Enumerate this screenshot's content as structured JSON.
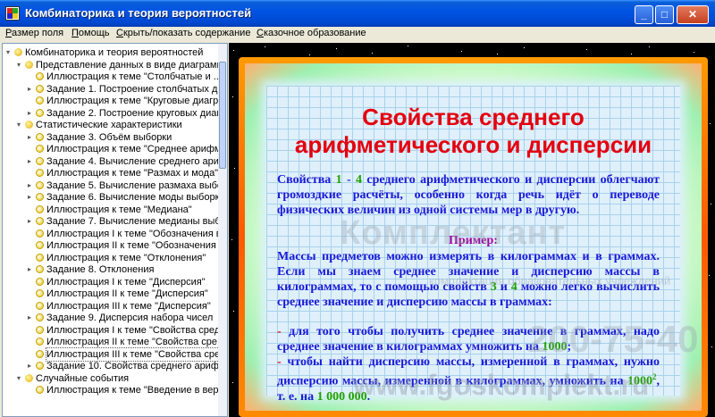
{
  "window": {
    "title": "Комбинаторика и теория вероятностей"
  },
  "menu": {
    "items": [
      {
        "pre": "",
        "u": "Р",
        "post": "азмер поля"
      },
      {
        "pre": "",
        "u": "П",
        "post": "омощь"
      },
      {
        "pre": "",
        "u": "С",
        "post": "крыть/показать содержание"
      },
      {
        "pre": "",
        "u": "С",
        "post": "казочное образование"
      }
    ]
  },
  "tree": [
    {
      "label": "Комбинаторика и теория вероятностей",
      "level": 0,
      "type": "folder",
      "exp": "-"
    },
    {
      "label": "Представление данных в виде диаграмм",
      "level": 1,
      "type": "folder",
      "exp": "-"
    },
    {
      "label": "Иллюстрация к теме \"Столбчатые и ...",
      "level": 2,
      "type": "page",
      "exp": ""
    },
    {
      "label": "Задание 1. Построение столбчатых д...",
      "level": 2,
      "type": "page",
      "exp": "+"
    },
    {
      "label": "Иллюстрация к теме \"Круговые диагр...",
      "level": 2,
      "type": "page",
      "exp": ""
    },
    {
      "label": "Задание 2. Построение круговых диаг...",
      "level": 2,
      "type": "page",
      "exp": "+"
    },
    {
      "label": "Статистические характеристики",
      "level": 1,
      "type": "folder",
      "exp": "-"
    },
    {
      "label": "Задание 3. Объём выборки",
      "level": 2,
      "type": "page",
      "exp": "+"
    },
    {
      "label": "Иллюстрация к теме \"Среднее арифм...",
      "level": 2,
      "type": "page",
      "exp": ""
    },
    {
      "label": "Задание 4. Вычисление среднего ари...",
      "level": 2,
      "type": "page",
      "exp": "+"
    },
    {
      "label": "Иллюстрация к теме \"Размах и мода\"",
      "level": 2,
      "type": "page",
      "exp": ""
    },
    {
      "label": "Задание 5. Вычисление размаха выбо...",
      "level": 2,
      "type": "page",
      "exp": "+"
    },
    {
      "label": "Задание 6. Вычисление моды выборки",
      "level": 2,
      "type": "page",
      "exp": "+"
    },
    {
      "label": "Иллюстрация к теме \"Медиана\"",
      "level": 2,
      "type": "page",
      "exp": ""
    },
    {
      "label": "Задание 7. Вычисление медианы выб...",
      "level": 2,
      "type": "page",
      "exp": "+"
    },
    {
      "label": "Иллюстрация I к теме \"Обозначения в...",
      "level": 2,
      "type": "page",
      "exp": ""
    },
    {
      "label": "Иллюстрация II к теме \"Обозначения ...",
      "level": 2,
      "type": "page",
      "exp": ""
    },
    {
      "label": "Иллюстрация к теме \"Отклонения\"",
      "level": 2,
      "type": "page",
      "exp": ""
    },
    {
      "label": "Задание 8. Отклонения",
      "level": 2,
      "type": "page",
      "exp": "+"
    },
    {
      "label": "Иллюстрация I к теме \"Дисперсия\"",
      "level": 2,
      "type": "page",
      "exp": ""
    },
    {
      "label": "Иллюстрация II к теме \"Дисперсия\"",
      "level": 2,
      "type": "page",
      "exp": ""
    },
    {
      "label": "Иллюстрация III к теме \"Дисперсия\"",
      "level": 2,
      "type": "page",
      "exp": ""
    },
    {
      "label": "Задание 9. Дисперсия набора чисел",
      "level": 2,
      "type": "page",
      "exp": "+"
    },
    {
      "label": "Иллюстрация I к теме \"Свойства сред...",
      "level": 2,
      "type": "page",
      "exp": ""
    },
    {
      "label": "Иллюстрация II к теме \"Свойства сре...",
      "level": 2,
      "type": "page",
      "exp": ""
    },
    {
      "label": "Иллюстрация III к теме \"Свойства сре...",
      "level": 2,
      "type": "page",
      "exp": "",
      "selected": true
    },
    {
      "label": "Задание 10. Свойства среднего ариф...",
      "level": 2,
      "type": "page",
      "exp": "+"
    },
    {
      "label": "Случайные события",
      "level": 1,
      "type": "folder",
      "exp": "-"
    },
    {
      "label": "Иллюстрация к теме \"Введение в вер...",
      "level": 2,
      "type": "page",
      "exp": ""
    }
  ],
  "slide": {
    "title_line1": "Свойства среднего",
    "title_line2": "арифметического и дисперсии",
    "intro": {
      "a": "Свойства ",
      "n1": "1",
      "b": " - ",
      "n2": "4",
      "c": " среднего арифметического и дисперсии облегчают громоздкие расчёты, особенно когда речь идёт о переводе физических величин из одной системы мер в другую."
    },
    "example_title": "Пример:",
    "example": {
      "a": "Массы предметов можно измерять в килограммах и в граммах. Если мы знаем среднее значение и дисперсию массы в килограммах, то с помощью свойств ",
      "n1": "3",
      "b": " и ",
      "n2": "4",
      "c": " можно легко вычислить среднее значение и дисперсию массы в граммах:"
    },
    "bullet1": {
      "dash": "-",
      "text": " для того чтобы получить среднее значение в граммах, надо среднее значение в килограммах умножить на ",
      "num": "1000",
      "end": ";"
    },
    "bullet2": {
      "dash": "-",
      "text": " чтобы найти дисперсию массы, измеренной в граммах, нужно дисперсию массы, измеренной в килограммах, умножить на ",
      "num": "1000",
      "sup": "2",
      "mid": ", т. е. на ",
      "num2": "1 000 000",
      "end": "."
    }
  },
  "watermark": {
    "logo": "Комплектант",
    "sub": "комплектация образовательных учреждений",
    "phone": "200-75-40",
    "url": "www.fgoskomplekt.ru"
  },
  "colors": {
    "title_red": "#e4000f",
    "text_blue": "#1a1ad8",
    "num_green": "#22a000",
    "example_purple": "#a0009a",
    "frame_orange": "#ff6a00"
  }
}
